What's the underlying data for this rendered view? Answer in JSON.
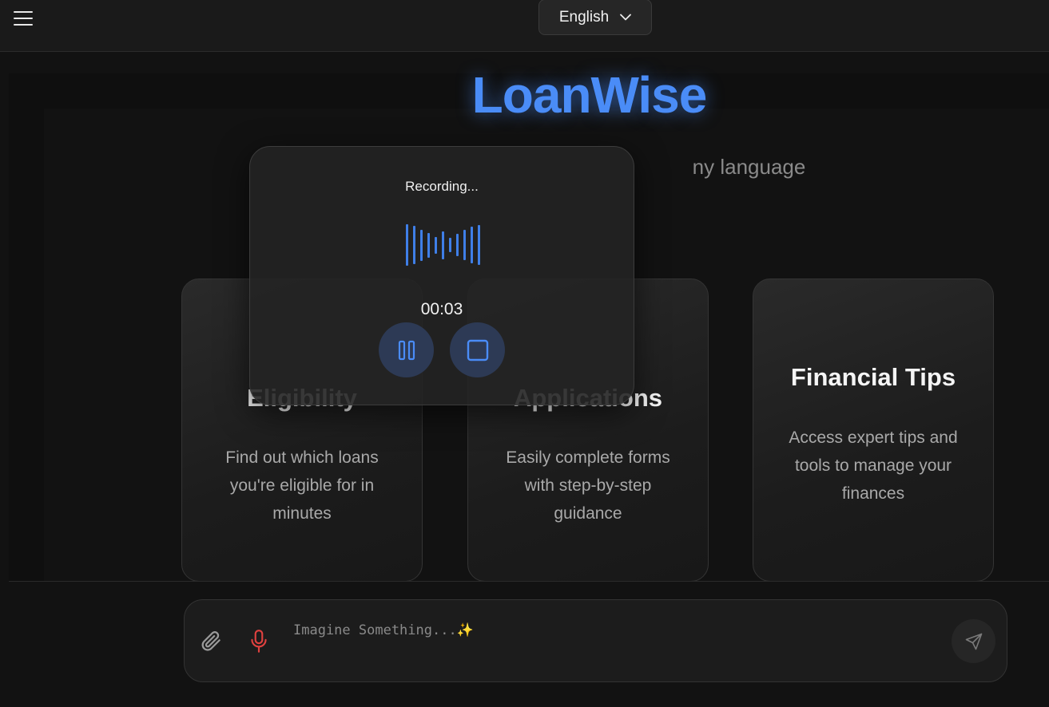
{
  "header": {
    "menu_icon": "hamburger-menu-icon",
    "language": {
      "selected": "English",
      "icon": "chevron-down-icon"
    }
  },
  "hero": {
    "brand": "LoanWise",
    "subtitle_visible": "ny language"
  },
  "cards": [
    {
      "title": "Eligibility",
      "description": "Find out which loans you're eligible for in minutes"
    },
    {
      "title": "Applications",
      "description": "Easily complete forms with step-by-step guidance"
    },
    {
      "title": "Financial Tips",
      "description": "Access expert tips and tools to manage your finances"
    }
  ],
  "recording": {
    "label": "Recording...",
    "timer": "00:03",
    "wave_levels": [
      0.92,
      0.85,
      0.7,
      0.55,
      0.38,
      0.62,
      0.32,
      0.5,
      0.68,
      0.82,
      0.9
    ],
    "pause_icon": "pause-icon",
    "stop_icon": "stop-icon"
  },
  "composer": {
    "placeholder": "Imagine Something...✨",
    "attach_icon": "paperclip-icon",
    "mic_icon": "microphone-icon",
    "send_icon": "send-icon"
  },
  "colors": {
    "accent": "#4a8cf7",
    "mic_active": "#e0413f",
    "background": "#121212"
  }
}
